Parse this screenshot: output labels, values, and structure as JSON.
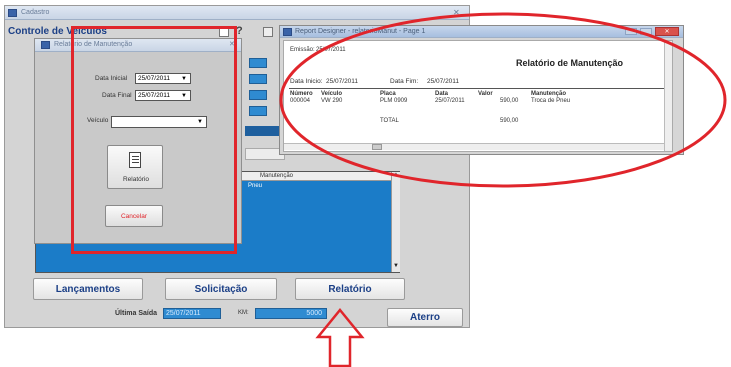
{
  "main_window": {
    "title": "Cadastro",
    "heading": "Controle de Veículos",
    "grid_header": "Manutenção",
    "grid_first_row": "Pneu",
    "buttons": {
      "lancamentos": "Lançamentos",
      "solicitacao": "Solicitação",
      "relatorio": "Relatório",
      "aterro": "Aterro"
    },
    "footer": {
      "ultima_saida_label": "Última Saída",
      "ultima_saida_value": "25/07/2011",
      "km_label": "KM:",
      "km_value": "5000"
    }
  },
  "dialog": {
    "title": "Relatório de Manutenção",
    "data_inicial_label": "Data Inicial",
    "data_inicial_value": "25/07/2011",
    "data_final_label": "Data Final",
    "data_final_value": "25/07/2011",
    "veiculo_label": "Veículo",
    "veiculo_value": "",
    "relatorio_button": "Relatório",
    "cancelar_button": "Cancelar"
  },
  "report": {
    "title": "Report Designer - relatorioManut - Page 1",
    "emissao_label": "Emissão:",
    "emissao_value": "25/07/2011",
    "heading": "Relatório de Manutenção",
    "data_inicio_label": "Data Inicio:",
    "data_inicio_value": "25/07/2011",
    "data_fim_label": "Data Fim:",
    "data_fim_value": "25/07/2011",
    "columns": [
      "Número",
      "Veículo",
      "Placa",
      "Data",
      "Valor",
      "Manutenção"
    ],
    "row": [
      "000004",
      "VW 290",
      "PLM 0909",
      "25/07/2011",
      "590,00",
      "Troca de Pneu"
    ],
    "total_label": "TOTAL",
    "total_value": "590,00"
  },
  "colors": {
    "annotation_red": "#e0252b",
    "grid_blue": "#1b7cc8",
    "window_gray": "#c8c8c8"
  }
}
